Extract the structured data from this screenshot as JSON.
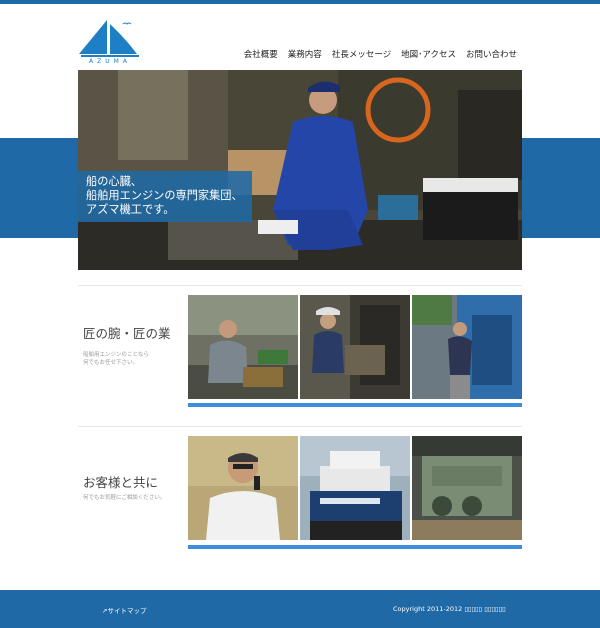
{
  "logo": {
    "text": "AZUMA"
  },
  "nav": [
    {
      "label": "会社概要"
    },
    {
      "label": "業務内容"
    },
    {
      "label": "社長メッセージ"
    },
    {
      "label": "地図･アクセス"
    },
    {
      "label": "お問い合わせ"
    }
  ],
  "hero": {
    "lines": [
      "船の心臓、",
      "船舶用エンジンの専門家集団、",
      "アズマ機工です。"
    ]
  },
  "section1": {
    "title": "匠の腕・匠の業",
    "desc_lines": [
      "船舶用エンジンのことなら",
      "何でもお任せ下さい。"
    ]
  },
  "section2": {
    "title": "お客様と共に",
    "desc_lines": [
      "何でもお気軽にご相談ください。"
    ]
  },
  "footer": {
    "sitemap": "サイトマップ",
    "copyright": "Copyright 2011-2012 ▯▯▯▯▯ ▯▯▯▯▯▯"
  },
  "colors": {
    "brand": "#1f6aa6",
    "strip": "#3d8ee0",
    "logo": "#1f7fc4"
  }
}
